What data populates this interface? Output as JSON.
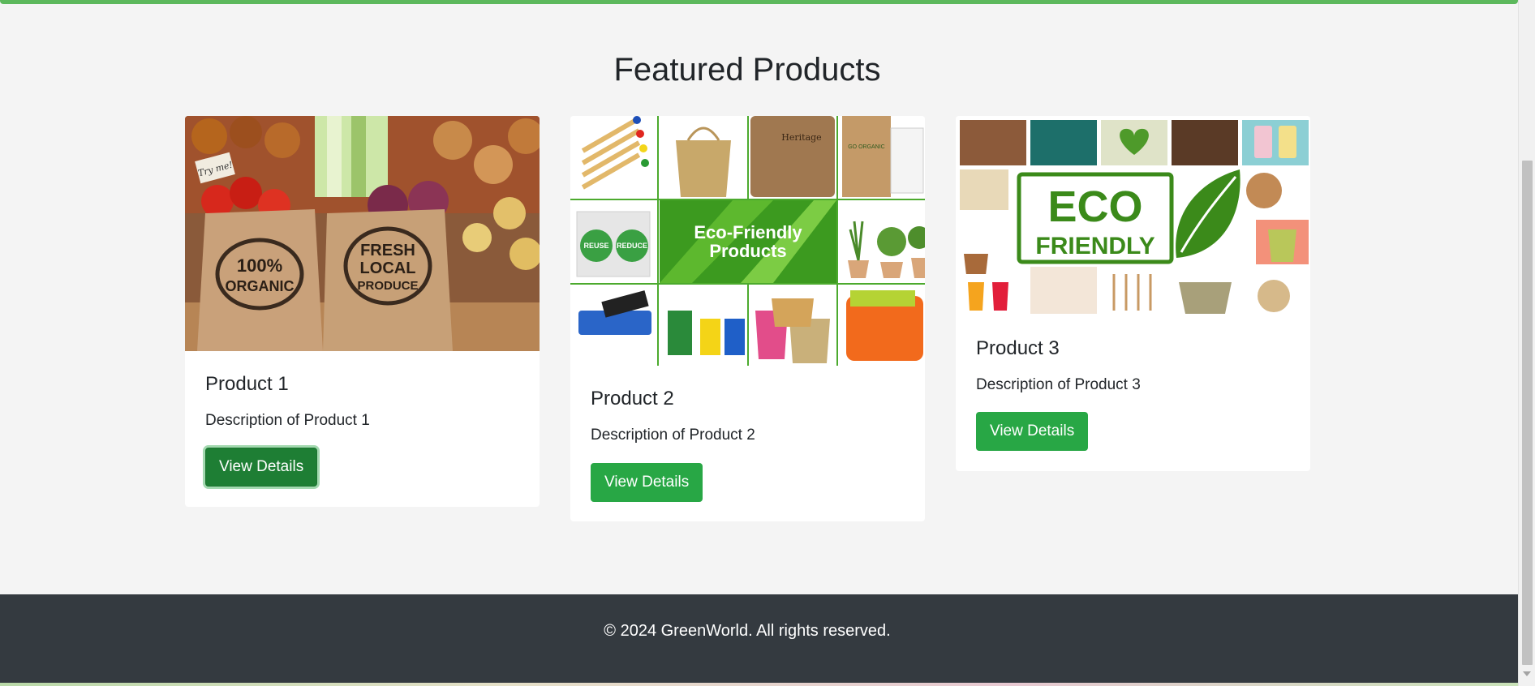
{
  "section": {
    "title": "Featured Products"
  },
  "products": [
    {
      "title": "Product 1",
      "description": "Description of Product 1",
      "button_label": "View Details",
      "image": {
        "bag_1_text": [
          "100%",
          "ORGANIC"
        ],
        "bag_2_text": [
          "FRESH",
          "LOCAL",
          "PRODUCE"
        ],
        "tag_text": "Try me!"
      }
    },
    {
      "title": "Product 2",
      "description": "Description of Product 2",
      "button_label": "View Details",
      "image": {
        "banner_text": [
          "Eco-Friendly",
          "Products"
        ],
        "cube_labels": [
          "REUSE",
          "REDUCE"
        ],
        "coaster_text": "Heritage",
        "notebook_text": "GO ORGANIC"
      }
    },
    {
      "title": "Product 3",
      "description": "Description of Product 3",
      "button_label": "View Details",
      "image": {
        "stamp_text": [
          "ECO",
          "FRIENDLY"
        ]
      }
    }
  ],
  "footer": {
    "text": "© 2024 GreenWorld. All rights reserved."
  },
  "colors": {
    "accent": "#5cb85c",
    "button": "#28a745",
    "button_focused": "#1e7e34",
    "footer_bg": "#343a40",
    "page_bg": "#f4f4f4"
  }
}
